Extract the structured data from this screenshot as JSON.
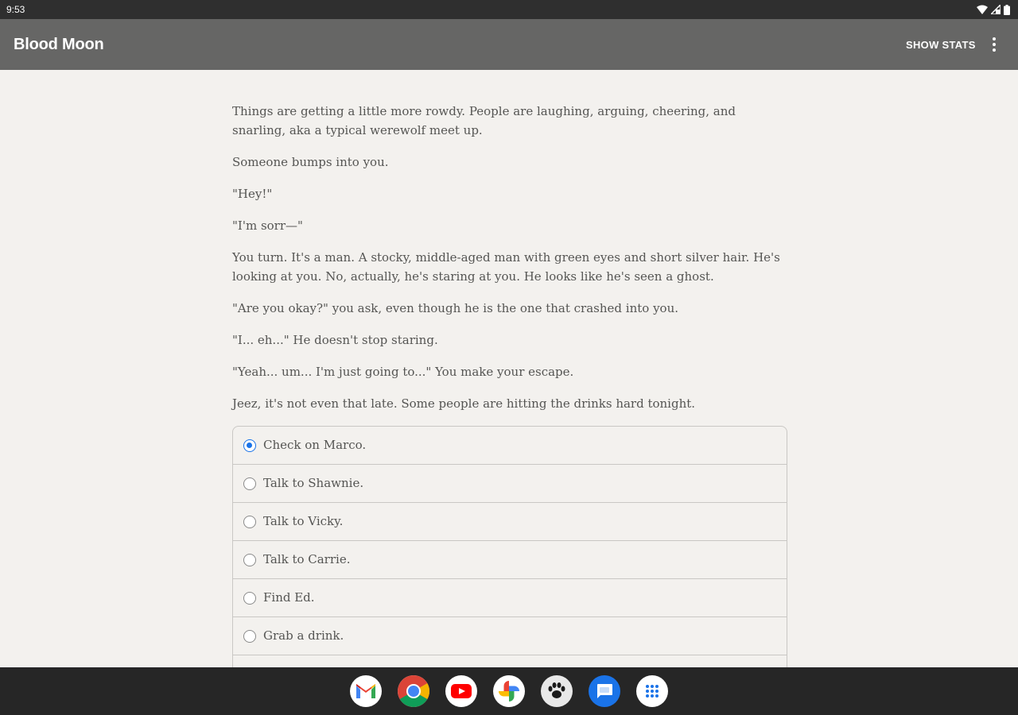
{
  "status_bar": {
    "time": "9:53"
  },
  "app_bar": {
    "title": "Blood Moon",
    "show_stats_label": "SHOW STATS"
  },
  "story": {
    "paragraphs": [
      "Things are getting a little more rowdy. People are laughing, arguing, cheering, and snarling, aka a typical werewolf meet up.",
      "Someone bumps into you.",
      "\"Hey!\"",
      "\"I'm sorr—\"",
      "You turn. It's a man. A stocky, middle-aged man with green eyes and short silver hair. He's looking at you. No, actually, he's staring at you. He looks like he's seen a ghost.",
      "\"Are you okay?\" you ask, even though he is the one that crashed into you.",
      "\"I... eh...\" He doesn't stop staring.",
      "\"Yeah... um... I'm just going to...\" You make your escape.",
      "Jeez, it's not even that late. Some people are hitting the drinks hard tonight."
    ]
  },
  "choices": [
    {
      "label": "Check on Marco.",
      "selected": true
    },
    {
      "label": "Talk to Shawnie.",
      "selected": false
    },
    {
      "label": "Talk to Vicky.",
      "selected": false
    },
    {
      "label": "Talk to Carrie.",
      "selected": false
    },
    {
      "label": "Find Ed.",
      "selected": false
    },
    {
      "label": "Grab a drink.",
      "selected": false
    }
  ],
  "dock": {
    "apps": [
      "gmail-icon",
      "chrome-icon",
      "youtube-icon",
      "photos-icon",
      "paw-app-icon",
      "messages-icon",
      "app-launcher-icon"
    ]
  },
  "colors": {
    "accent": "#1a73e8",
    "app_bar": "#666665",
    "background": "#f3f1ee"
  }
}
